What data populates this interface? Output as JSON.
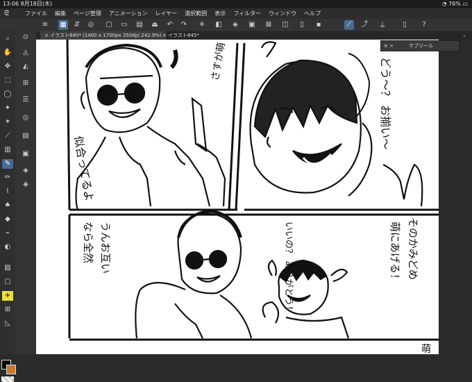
{
  "status": {
    "time": "13:06",
    "date": "8月18日(木)",
    "battery": "76%"
  },
  "menu": {
    "items": [
      "ファイル",
      "編集",
      "ページ管理",
      "アニメーション",
      "レイヤー",
      "選択範囲",
      "表示",
      "フィルター",
      "ウィンドウ",
      "ヘルプ"
    ]
  },
  "tabs": [
    {
      "label": "イラスト840* (1400 x 1700px 350dpi 242.9%)",
      "close": "×"
    },
    {
      "label": "イラスト845*",
      "close": "×"
    }
  ],
  "subtool": {
    "controls": "≡ ×",
    "title": "サブツール"
  },
  "manga": {
    "p1_text_a": "さすが萌",
    "p1_text_b": "似合ってるよ",
    "p2_text": "どう〜？ お揃い〜",
    "p3_text_a": "うんお互い",
    "p3_text_b": "なら全然",
    "p3_text_c": "いいの？ ありがとう！",
    "p3_text_d": "そのかみどめ",
    "p3_text_e": "萌にあげる！",
    "p4_text": "萌"
  },
  "colors": {
    "accent": "#4a6a8f",
    "highlight": "#e5e23a",
    "sub_color": "#c87a2a"
  }
}
